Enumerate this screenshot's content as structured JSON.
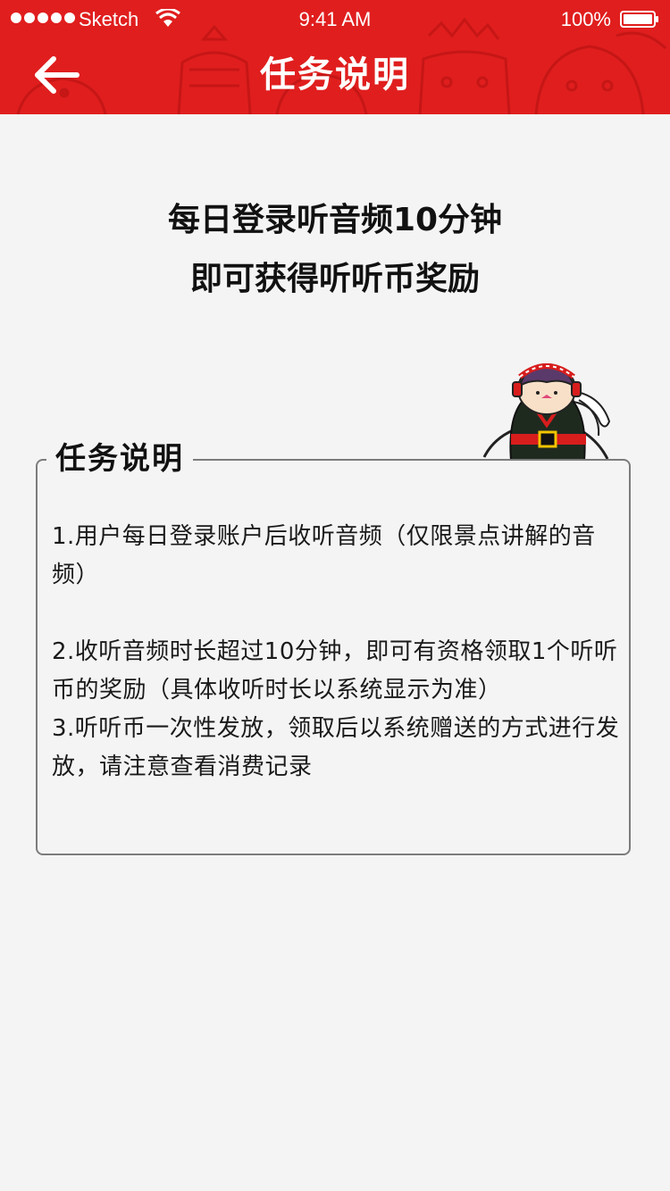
{
  "status_bar": {
    "carrier": "Sketch",
    "time": "9:41 AM",
    "battery": "100%"
  },
  "header": {
    "title": "任务说明",
    "back_icon": "arrow-left-icon",
    "brand_color": "#e01e1e"
  },
  "headline": {
    "line1": "每日登录听音频10分钟",
    "line2": "即可获得听听币奖励"
  },
  "task": {
    "title": "任务说明",
    "rules": [
      "1.用户每日登录账户后收听音频（仅限景点讲解的音频）",
      "2.收听音频时长超过10分钟，即可有资格领取1个听听币的奖励（具体收听时长以系统显示为准）",
      "3.听听币一次性发放，领取后以系统赠送的方式进行发放，请注意查看消费记录"
    ]
  }
}
